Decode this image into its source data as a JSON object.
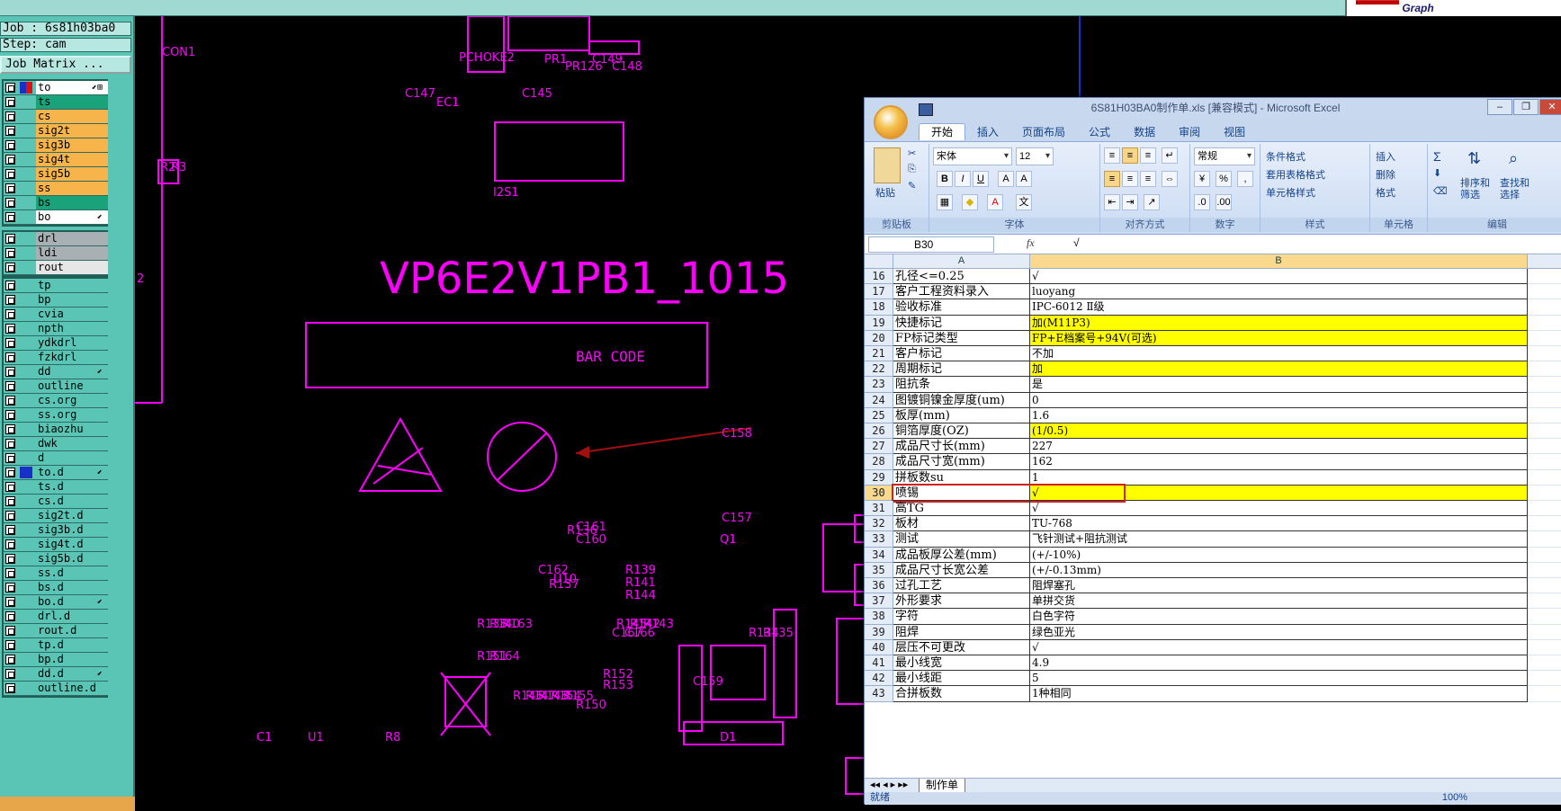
{
  "cam": {
    "job": "Job : 6s81h03ba0",
    "step": "Step: cam",
    "matrix_button": "Job Matrix ...",
    "groups": [
      [
        {
          "name": "to",
          "color": "#ffffff",
          "flag": "⬋⊞"
        },
        {
          "name": "ts",
          "color": "#1aa37a",
          "flag": ""
        },
        {
          "name": "cs",
          "color": "#f6b44a",
          "flag": ""
        },
        {
          "name": "sig2t",
          "color": "#f6b44a",
          "flag": ""
        },
        {
          "name": "sig3b",
          "color": "#f6b44a",
          "flag": ""
        },
        {
          "name": "sig4t",
          "color": "#f6b44a",
          "flag": ""
        },
        {
          "name": "sig5b",
          "color": "#f6b44a",
          "flag": ""
        },
        {
          "name": "ss",
          "color": "#f6b44a",
          "flag": ""
        },
        {
          "name": "bs",
          "color": "#1aa37a",
          "flag": ""
        },
        {
          "name": "bo",
          "color": "#ffffff",
          "flag": "⬋"
        }
      ],
      [
        {
          "name": "drl",
          "color": "#a8b0b4",
          "flag": ""
        },
        {
          "name": "ldi",
          "color": "#a8b0b4",
          "flag": ""
        },
        {
          "name": "rout",
          "color": "#e6e6e6",
          "flag": ""
        }
      ],
      [
        {
          "name": "tp",
          "color": "#5bc5b5",
          "flag": ""
        },
        {
          "name": "bp",
          "color": "#5bc5b5",
          "flag": ""
        },
        {
          "name": "cvia",
          "color": "#5bc5b5",
          "flag": ""
        },
        {
          "name": "npth",
          "color": "#5bc5b5",
          "flag": ""
        },
        {
          "name": "ydkdrl",
          "color": "#5bc5b5",
          "flag": ""
        },
        {
          "name": "fzkdrl",
          "color": "#5bc5b5",
          "flag": ""
        },
        {
          "name": "dd",
          "color": "#5bc5b5",
          "flag": "⬋"
        },
        {
          "name": "outline",
          "color": "#5bc5b5",
          "flag": ""
        },
        {
          "name": "cs.org",
          "color": "#5bc5b5",
          "flag": ""
        },
        {
          "name": "ss.org",
          "color": "#5bc5b5",
          "flag": ""
        },
        {
          "name": "biaozhu",
          "color": "#5bc5b5",
          "flag": ""
        },
        {
          "name": "dwk",
          "color": "#5bc5b5",
          "flag": ""
        },
        {
          "name": "d",
          "color": "#5bc5b5",
          "flag": ""
        },
        {
          "name": "to.d",
          "color": "#5bc5b5",
          "flag": "⬋"
        },
        {
          "name": "ts.d",
          "color": "#5bc5b5",
          "flag": ""
        },
        {
          "name": "cs.d",
          "color": "#5bc5b5",
          "flag": ""
        },
        {
          "name": "sig2t.d",
          "color": "#5bc5b5",
          "flag": ""
        },
        {
          "name": "sig3b.d",
          "color": "#5bc5b5",
          "flag": ""
        },
        {
          "name": "sig4t.d",
          "color": "#5bc5b5",
          "flag": ""
        },
        {
          "name": "sig5b.d",
          "color": "#5bc5b5",
          "flag": ""
        },
        {
          "name": "ss.d",
          "color": "#5bc5b5",
          "flag": ""
        },
        {
          "name": "bs.d",
          "color": "#5bc5b5",
          "flag": ""
        },
        {
          "name": "bo.d",
          "color": "#5bc5b5",
          "flag": "⬋"
        },
        {
          "name": "drl.d",
          "color": "#5bc5b5",
          "flag": ""
        },
        {
          "name": "rout.d",
          "color": "#5bc5b5",
          "flag": ""
        },
        {
          "name": "tp.d",
          "color": "#5bc5b5",
          "flag": ""
        },
        {
          "name": "bp.d",
          "color": "#5bc5b5",
          "flag": ""
        },
        {
          "name": "dd.d",
          "color": "#5bc5b5",
          "flag": "⬋"
        },
        {
          "name": "outline.d",
          "color": "#5bc5b5",
          "flag": ""
        }
      ]
    ]
  },
  "cad": {
    "title_text": "VP6E2V1PB1_1015",
    "barcode_text": "BAR CODE",
    "labels": [
      "CON1",
      "PCHOKE2",
      "PR1",
      "PR126",
      "C149",
      "C148",
      "C147",
      "EC1",
      "C145",
      "I2S1",
      "R2",
      "R3",
      "2",
      "C158",
      "C157",
      "Q1",
      "R136",
      "C161",
      "C160",
      "C162",
      "U10",
      "R139",
      "R141",
      "R144",
      "R137",
      "R138",
      "R140",
      "R163",
      "R151",
      "R164",
      "R145",
      "R142",
      "R143",
      "C167",
      "C166",
      "R134",
      "R135",
      "R152",
      "R153",
      "C159",
      "D1",
      "C1",
      "U1",
      "R8",
      "R146",
      "R147",
      "R148",
      "R154",
      "R155",
      "R150"
    ],
    "colors": {
      "trace": "#ff00ff",
      "arrow": "#a01010"
    }
  },
  "excel": {
    "title": "6S81H03BA0制作单.xls  [兼容模式]  -  Microsoft Excel",
    "tabs": [
      "开始",
      "插入",
      "页面布局",
      "公式",
      "数据",
      "审阅",
      "视图"
    ],
    "active_tab": "开始",
    "ribbon": {
      "paste": "粘贴",
      "font_name": "宋体",
      "font_size": "12",
      "number_format": "常规",
      "cond_format": "条件格式",
      "table_format": "套用表格格式",
      "cell_style": "单元格样式",
      "insert": "插入",
      "delete": "删除",
      "format": "格式",
      "sort_filter": "排序和\n筛选",
      "find_select": "查找和\n选择",
      "groups": [
        "剪贴板",
        "字体",
        "对齐方式",
        "数字",
        "样式",
        "单元格",
        "编辑"
      ]
    },
    "name_box": "B30",
    "formula_value": "√",
    "columns": [
      "A",
      "B"
    ],
    "rows": [
      {
        "n": "16",
        "a": "孔径<=0.25",
        "b": "√",
        "y": false
      },
      {
        "n": "17",
        "a": "客户工程资料录入",
        "b": "luoyang",
        "y": false
      },
      {
        "n": "18",
        "a": "验收标准",
        "b": "IPC-6012 Ⅱ级",
        "y": false
      },
      {
        "n": "19",
        "a": "快捷标记",
        "b": "加(M11P3)",
        "y": true
      },
      {
        "n": "20",
        "a": "FP标记类型",
        "b": "FP+E档案号+94V(可选)",
        "y": true
      },
      {
        "n": "21",
        "a": "客户标记",
        "b": "不加",
        "y": false
      },
      {
        "n": "22",
        "a": "周期标记",
        "b": "加",
        "y": true
      },
      {
        "n": "23",
        "a": "阻抗条",
        "b": "是",
        "y": false
      },
      {
        "n": "24",
        "a": "图镀铜镍金厚度(um)",
        "b": "0",
        "y": false
      },
      {
        "n": "25",
        "a": "板厚(mm)",
        "b": "1.6",
        "y": false
      },
      {
        "n": "26",
        "a": "铜箔厚度(OZ)",
        "b": " (1/0.5)",
        "y": true
      },
      {
        "n": "27",
        "a": "成品尺寸长(mm)",
        "b": "227",
        "y": false
      },
      {
        "n": "28",
        "a": "成品尺寸宽(mm)",
        "b": "162",
        "y": false
      },
      {
        "n": "29",
        "a": "拼板数su",
        "b": "1",
        "y": false
      },
      {
        "n": "30",
        "a": "喷锡",
        "b": "√",
        "y": true
      },
      {
        "n": "31",
        "a": "高TG",
        "b": "√",
        "y": false
      },
      {
        "n": "32",
        "a": "板材",
        "b": "TU-768",
        "y": false
      },
      {
        "n": "33",
        "a": "测试",
        "b": "飞针测试+阻抗测试",
        "y": false
      },
      {
        "n": "34",
        "a": "成品板厚公差(mm)",
        "b": "(+/-10%)",
        "y": false
      },
      {
        "n": "35",
        "a": "成品尺寸长宽公差",
        "b": "(+/-0.13mm)",
        "y": false
      },
      {
        "n": "36",
        "a": "过孔工艺",
        "b": "阻焊塞孔",
        "y": false
      },
      {
        "n": "37",
        "a": "外形要求",
        "b": "单拼交货",
        "y": false
      },
      {
        "n": "38",
        "a": "字符",
        "b": "白色字符",
        "y": false
      },
      {
        "n": "39",
        "a": "阻焊",
        "b": "绿色亚光",
        "y": false
      },
      {
        "n": "40",
        "a": "层压不可更改",
        "b": "√",
        "y": false
      },
      {
        "n": "41",
        "a": "最小线宽",
        "b": "4.9",
        "y": false
      },
      {
        "n": "42",
        "a": "最小线距",
        "b": "5",
        "y": false
      },
      {
        "n": "43",
        "a": "合拼板数",
        "b": "1种相同",
        "y": false
      }
    ],
    "selected_row": "30",
    "sheet_tab": "制作单",
    "status": "就绪",
    "zoom": "100%"
  }
}
